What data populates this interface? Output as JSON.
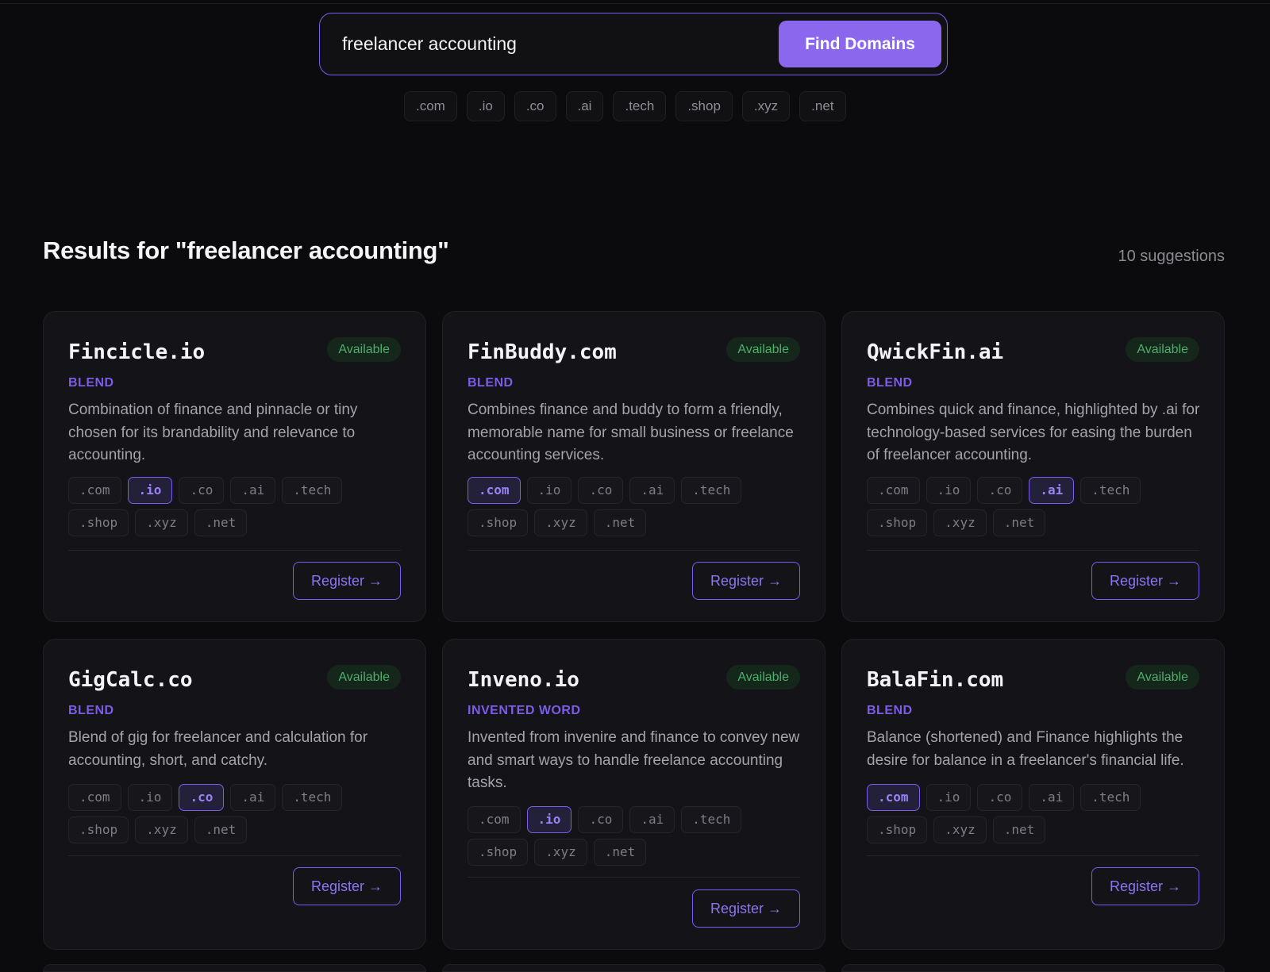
{
  "search": {
    "value": "freelancer accounting",
    "button": "Find Domains"
  },
  "tld_filters": [
    ".com",
    ".io",
    ".co",
    ".ai",
    ".tech",
    ".shop",
    ".xyz",
    ".net"
  ],
  "results": {
    "title": "Results for \"freelancer accounting\"",
    "count": "10 suggestions"
  },
  "colors": {
    "accent": "#7b5cf0",
    "available": "#4caf6a",
    "background": "#0b0b0d",
    "card": "#141418"
  },
  "cards": [
    {
      "name": "Fincicle.io",
      "status": "Available",
      "kind": "BLEND",
      "description": "Combination of finance and pinnacle or tiny chosen for its brandability and relevance to accounting.",
      "tlds": [
        ".com",
        ".io",
        ".co",
        ".ai",
        ".tech",
        ".shop",
        ".xyz",
        ".net"
      ],
      "selected": ".io",
      "button": "Register →"
    },
    {
      "name": "FinBuddy.com",
      "status": "Available",
      "kind": "BLEND",
      "description": "Combines finance and buddy to form a friendly, memorable name for small business or freelance accounting services.",
      "tlds": [
        ".com",
        ".io",
        ".co",
        ".ai",
        ".tech",
        ".shop",
        ".xyz",
        ".net"
      ],
      "selected": ".com",
      "button": "Register →"
    },
    {
      "name": "QwickFin.ai",
      "status": "Available",
      "kind": "BLEND",
      "description": "Combines quick and finance, highlighted by .ai for technology-based services for easing the burden of freelancer accounting.",
      "tlds": [
        ".com",
        ".io",
        ".co",
        ".ai",
        ".tech",
        ".shop",
        ".xyz",
        ".net"
      ],
      "selected": ".ai",
      "button": "Register →"
    },
    {
      "name": "GigCalc.co",
      "status": "Available",
      "kind": "BLEND",
      "description": "Blend of gig for freelancer and calculation for accounting, short, and catchy.",
      "tlds": [
        ".com",
        ".io",
        ".co",
        ".ai",
        ".tech",
        ".shop",
        ".xyz",
        ".net"
      ],
      "selected": ".co",
      "button": "Register →"
    },
    {
      "name": "Inveno.io",
      "status": "Available",
      "kind": "INVENTED WORD",
      "description": "Invented from invenire and finance to convey new and smart ways to handle freelance accounting tasks.",
      "tlds": [
        ".com",
        ".io",
        ".co",
        ".ai",
        ".tech",
        ".shop",
        ".xyz",
        ".net"
      ],
      "selected": ".io",
      "button": "Register →"
    },
    {
      "name": "BalaFin.com",
      "status": "Available",
      "kind": "BLEND",
      "description": "Balance (shortened) and Finance highlights the desire for balance in a freelancer's financial life.",
      "tlds": [
        ".com",
        ".io",
        ".co",
        ".ai",
        ".tech",
        ".shop",
        ".xyz",
        ".net"
      ],
      "selected": ".com",
      "button": "Register →"
    }
  ]
}
